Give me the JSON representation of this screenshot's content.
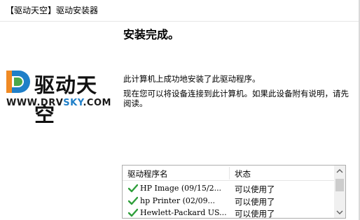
{
  "window": {
    "title": "【驱动天空】驱动安装器"
  },
  "logo": {
    "text_cn": "驱动天空",
    "url_part1": "WWW.DRV",
    "url_part2": "SKY",
    "url_part3": ".COM",
    "colors": {
      "orange": "#f08a24",
      "green": "#4aa84a",
      "blue": "#1f7fc8"
    }
  },
  "content": {
    "heading": "安装完成。",
    "message1": "此计算机上成功地安装了此驱动程序。",
    "message2": "现在您可以将设备连接到此计算机。如果此设备附有说明，请先阅读。"
  },
  "driver_list": {
    "columns": [
      "驱动程序名",
      "状态"
    ],
    "rows": [
      {
        "name": "HP Image   (09/15/2...",
        "status": "可以使用了"
      },
      {
        "name": "hp Printer   (02/09...",
        "status": "可以使用了"
      },
      {
        "name": "Hewlett-Packard US...",
        "status": "可以使用了"
      }
    ]
  },
  "icons": {
    "check": "green-check-icon",
    "scroll_up": "chevron-up-icon",
    "scroll_down": "chevron-down-icon"
  }
}
